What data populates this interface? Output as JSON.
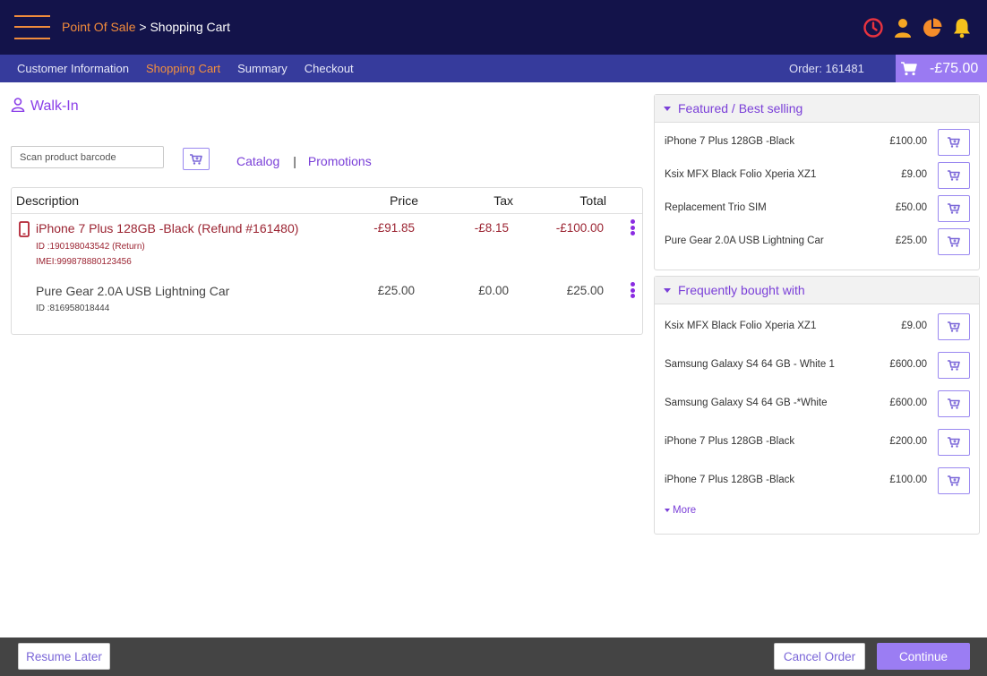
{
  "header": {
    "breadcrumb_root": "Point Of Sale",
    "breadcrumb_separator": " > ",
    "breadcrumb_current": "Shopping Cart",
    "icons": [
      "clock-icon",
      "user-icon",
      "pie-chart-icon",
      "bell-icon"
    ],
    "icon_colors": {
      "clock": "#e8333f",
      "user": "#f5a623",
      "pie": "#f58c2a",
      "bell": "#f7c21c"
    }
  },
  "nav": {
    "tabs": [
      "Customer Information",
      "Shopping Cart",
      "Summary",
      "Checkout"
    ],
    "active_tab": "Shopping Cart",
    "order_label": "Order: 161481",
    "cart_total": "-£75.00"
  },
  "customer": {
    "name": "Walk-In"
  },
  "scan": {
    "placeholder": "Scan product barcode"
  },
  "links": {
    "catalog": "Catalog",
    "separator": "|",
    "promotions": "Promotions"
  },
  "cart": {
    "headers": {
      "description": "Description",
      "price": "Price",
      "tax": "Tax",
      "total": "Total"
    },
    "items": [
      {
        "name": "iPhone 7 Plus 128GB -Black (Refund #161480)",
        "id": "ID :190198043542 (Return)",
        "imei": "IMEI:999878880123456",
        "price": "-£91.85",
        "tax": "-£8.15",
        "total": "-£100.00",
        "is_refund": true
      },
      {
        "name": "Pure Gear 2.0A USB Lightning Car",
        "id": "ID :816958018444",
        "price": "£25.00",
        "tax": "£0.00",
        "total": "£25.00",
        "is_refund": false
      }
    ]
  },
  "featured": {
    "title": "Featured / Best selling",
    "items": [
      {
        "name": "iPhone 7 Plus 128GB -Black",
        "price": "£100.00"
      },
      {
        "name": "Ksix MFX Black Folio Xperia XZ1",
        "price": "£9.00"
      },
      {
        "name": "Replacement Trio SIM",
        "price": "£50.00"
      },
      {
        "name": "Pure Gear 2.0A USB Lightning Car",
        "price": "£25.00"
      }
    ]
  },
  "frequently": {
    "title": "Frequently bought with",
    "items": [
      {
        "name": "Ksix MFX Black Folio Xperia XZ1",
        "price": "£9.00"
      },
      {
        "name": "Samsung Galaxy S4 64 GB - White 1",
        "price": "£600.00"
      },
      {
        "name": "Samsung Galaxy S4 64 GB -*White",
        "price": "£600.00"
      },
      {
        "name": "iPhone 7 Plus 128GB -Black",
        "price": "£200.00"
      },
      {
        "name": "iPhone 7 Plus 128GB -Black",
        "price": "£100.00"
      }
    ],
    "more_label": "More"
  },
  "footer": {
    "resume_label": "Resume Later",
    "cancel_label": "Cancel Order",
    "continue_label": "Continue"
  },
  "colors": {
    "topbar": "#13134a",
    "navbar": "#363b9c",
    "accent_orange": "#f4903c",
    "accent_purple": "#7a3fd8",
    "refund_red": "#9b2331",
    "cart_total_bg": "#9a7af2",
    "footer": "#444444"
  }
}
